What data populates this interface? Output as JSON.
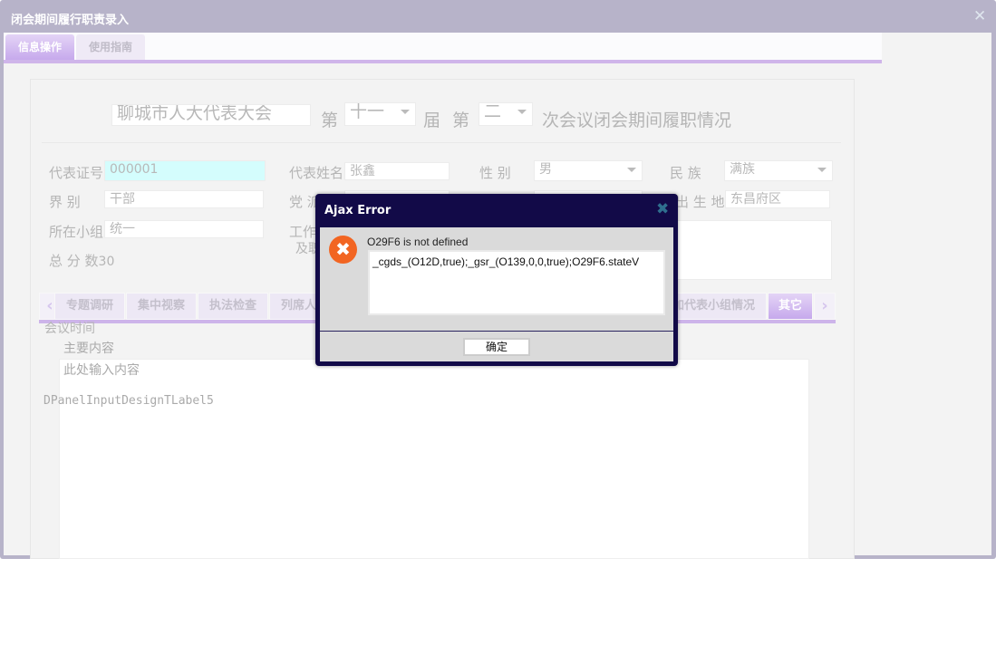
{
  "window": {
    "title": "闭会期间履行职责录入",
    "close_icon": "close-icon"
  },
  "top_tabs": [
    {
      "label": "信息操作",
      "active": true
    },
    {
      "label": "使用指南",
      "active": false
    }
  ],
  "header": {
    "org_value": "聊城市人大代表大会",
    "di1": "第",
    "session_value": "十一",
    "jie": "届",
    "di2": "第",
    "meeting_value": "二",
    "suffix": "次会议闭会期间履职情况"
  },
  "fields": {
    "rep_id": {
      "label": "代表证号",
      "value": "000001"
    },
    "rep_name": {
      "label": "代表姓名",
      "value": "张鑫"
    },
    "gender": {
      "label": "性 别",
      "value": "男"
    },
    "ethnicity": {
      "label": "民 族",
      "value": "满族"
    },
    "sector": {
      "label": "界 别",
      "value": "干部"
    },
    "party": {
      "label": "党 派"
    },
    "birthplace": {
      "label": "出 生 地",
      "value": "东昌府区"
    },
    "group": {
      "label": "所在小组",
      "value": "统一"
    },
    "work_label_1": "工作",
    "work_label_2": "及职",
    "score": {
      "label": "总 分 数",
      "value": "30"
    }
  },
  "sub_tabs": [
    "专题调研",
    "集中视察",
    "执法检查",
    "列席人",
    "加代表小组情况",
    "其它"
  ],
  "content": {
    "meeting_time_label": "会议时间",
    "main_content_label": "主要内容",
    "placeholder": "此处输入内容",
    "design_label": "DPanelInputDesignTLabel5"
  },
  "dialog": {
    "title": "Ajax Error",
    "message": "O29F6 is not defined",
    "detail": "_cgds_(O12D,true);_gsr_(O139,0,0,true);O29F6.stateV",
    "ok": "确定",
    "icon": "error-icon",
    "header_color": "#120a48",
    "icon_color": "#f26522"
  }
}
